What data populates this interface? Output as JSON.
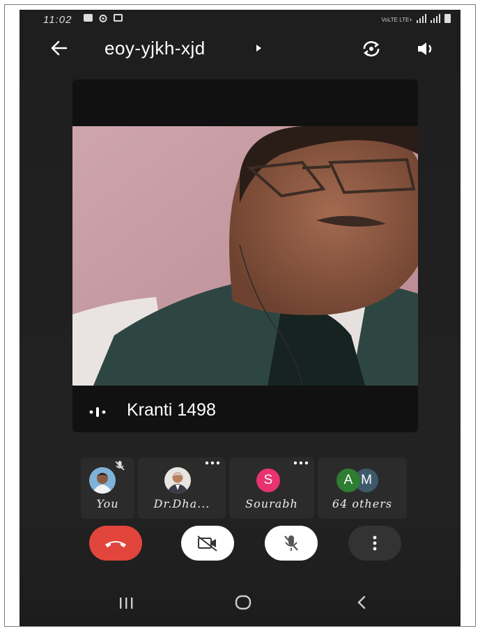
{
  "status_bar": {
    "time": "11:02",
    "icons": [
      "message-icon",
      "settings-icon",
      "video-icon"
    ],
    "network_label": "VoLTE LTE+"
  },
  "header": {
    "meeting_code": "eoy-yjkh-xjd",
    "back_icon": "back-arrow-icon",
    "switch_camera_icon": "switch-camera-icon",
    "speaker_icon": "speaker-icon"
  },
  "main_video": {
    "speaker_name": "Kranti 1498",
    "audio_indicator_icon": "audio-wave-icon"
  },
  "participants": [
    {
      "label": "You",
      "type": "photo",
      "muted": true
    },
    {
      "label": "Dr.Dha...",
      "type": "photo",
      "menu": true
    },
    {
      "label": "Sourabh",
      "type": "initial",
      "initial": "S",
      "color": "#e8336f",
      "menu": true
    },
    {
      "label": "64 others",
      "type": "initials",
      "initials": [
        "A",
        "M"
      ],
      "colors": [
        "#2e7d32",
        "#3d5a6b"
      ]
    }
  ],
  "controls": {
    "end_call_color": "#e2453c",
    "buttons": [
      "end-call-icon",
      "camera-off-icon",
      "mic-off-icon",
      "more-options-icon"
    ]
  },
  "nav_bar": {
    "buttons": [
      "recent-apps-icon",
      "home-icon",
      "back-icon"
    ]
  }
}
